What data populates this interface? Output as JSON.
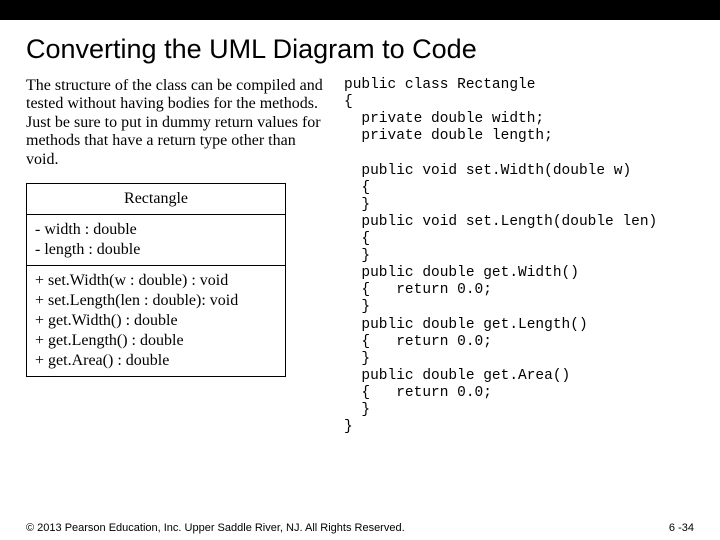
{
  "title": "Converting the UML Diagram to Code",
  "paragraph": "The structure of the class can be compiled and tested without having bodies for the methods.  Just be sure to put in dummy return values for methods that have a return type other than void.",
  "uml": {
    "className": "Rectangle",
    "attributes": "- width : double\n- length : double",
    "operations": "+ set.Width(w : double) : void\n+ set.Length(len : double): void\n+ get.Width() : double\n+ get.Length() : double\n+ get.Area() : double"
  },
  "code": "public class Rectangle\n{\n  private double width;\n  private double length;\n\n  public void set.Width(double w)\n  {\n  }\n  public void set.Length(double len)\n  {\n  }\n  public double get.Width()\n  {   return 0.0;\n  }\n  public double get.Length()\n  {   return 0.0;\n  }\n  public double get.Area()\n  {   return 0.0;\n  }\n}",
  "footer": {
    "copyright": "© 2013 Pearson Education, Inc. Upper Saddle River, NJ. All Rights Reserved.",
    "pagenum": "6 -34"
  }
}
